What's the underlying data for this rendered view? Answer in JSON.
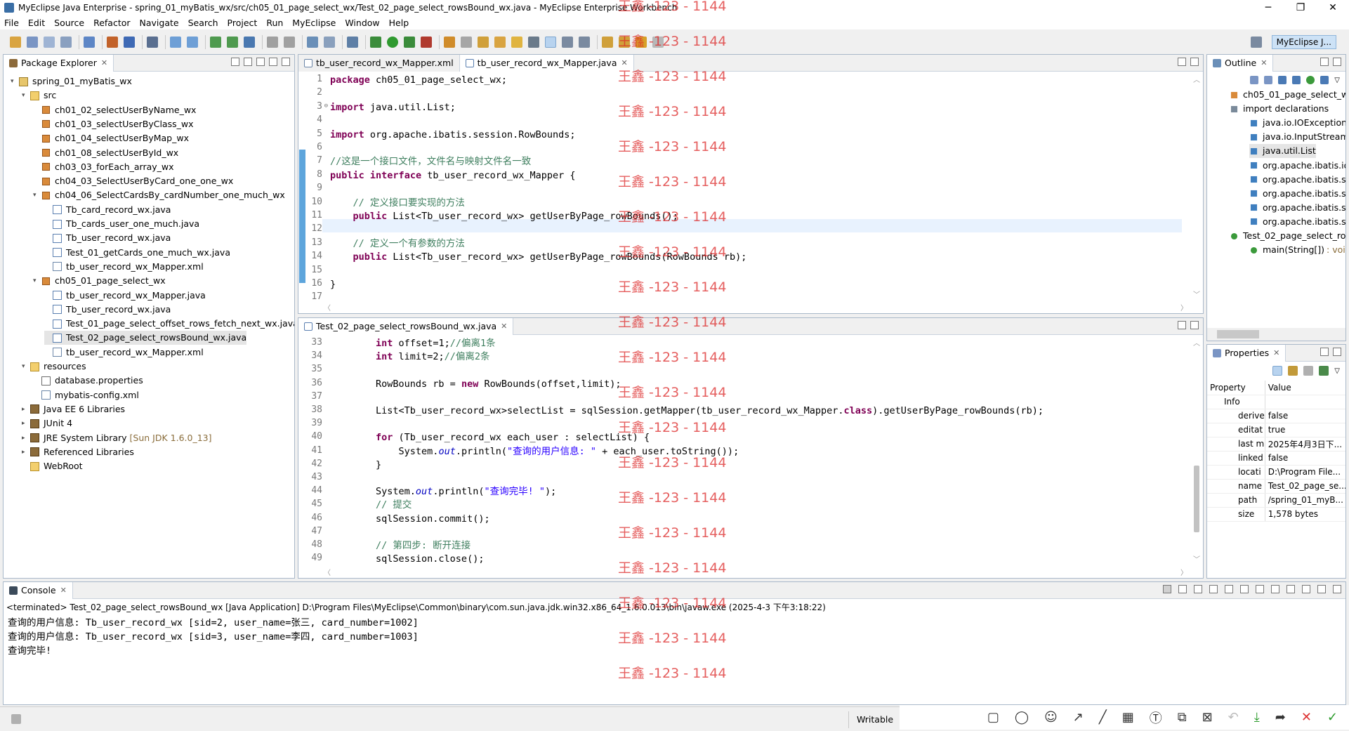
{
  "window": {
    "title": "MyEclipse Java Enterprise - spring_01_myBatis_wx/src/ch05_01_page_select_wx/Test_02_page_select_rowsBound_wx.java - MyEclipse Enterprise Workbench"
  },
  "menu": [
    "File",
    "Edit",
    "Source",
    "Refactor",
    "Navigate",
    "Search",
    "Project",
    "Run",
    "MyEclipse",
    "Window",
    "Help"
  ],
  "perspective_label": "MyEclipse J...",
  "package_explorer": {
    "tab": "Package Explorer",
    "items": [
      {
        "label": "spring_01_myBatis_wx",
        "icon": "project-icon"
      },
      {
        "label": "src",
        "icon": "source-folder-icon"
      },
      {
        "label": "ch01_02_selectUserByName_wx",
        "icon": "package-icon"
      },
      {
        "label": "ch01_03_selectUserByClass_wx",
        "icon": "package-icon"
      },
      {
        "label": "ch01_04_selectUserByMap_wx",
        "icon": "package-icon"
      },
      {
        "label": "ch01_08_selectUserById_wx",
        "icon": "package-icon"
      },
      {
        "label": "ch03_03_forEach_array_wx",
        "icon": "package-icon"
      },
      {
        "label": "ch04_03_SelectUserByCard_one_one_wx",
        "icon": "package-icon"
      },
      {
        "label": "ch04_06_SelectCardsBy_cardNumber_one_much_wx",
        "icon": "package-icon"
      },
      {
        "label": "Tb_card_record_wx.java",
        "icon": "java-file-icon"
      },
      {
        "label": "Tb_cards_user_one_much.java",
        "icon": "java-file-icon"
      },
      {
        "label": "Tb_user_record_wx.java",
        "icon": "java-file-icon"
      },
      {
        "label": "Test_01_getCards_one_much_wx.java",
        "icon": "java-file-icon"
      },
      {
        "label": "tb_user_record_wx_Mapper.xml",
        "icon": "xml-file-icon"
      },
      {
        "label": "ch05_01_page_select_wx",
        "icon": "package-icon"
      },
      {
        "label": "tb_user_record_wx_Mapper.java",
        "icon": "java-file-icon"
      },
      {
        "label": "Tb_user_record_wx.java",
        "icon": "java-file-icon"
      },
      {
        "label": "Test_01_page_select_offset_rows_fetch_next_wx.java",
        "icon": "java-file-icon"
      },
      {
        "label": "Test_02_page_select_rowsBound_wx.java",
        "icon": "java-file-icon"
      },
      {
        "label": "tb_user_record_wx_Mapper.xml",
        "icon": "xml-file-icon"
      },
      {
        "label": "resources",
        "icon": "source-folder-icon"
      },
      {
        "label": "database.properties",
        "icon": "properties-file-icon"
      },
      {
        "label": "mybatis-config.xml",
        "icon": "xml-file-icon"
      },
      {
        "label": "Java EE 6 Libraries",
        "icon": "library-icon"
      },
      {
        "label": "JUnit 4",
        "icon": "library-icon"
      },
      {
        "label": "JRE System Library",
        "suffix": "[Sun JDK 1.6.0_13]",
        "icon": "library-icon"
      },
      {
        "label": "Referenced Libraries",
        "icon": "library-icon"
      },
      {
        "label": "WebRoot",
        "icon": "folder-icon"
      }
    ]
  },
  "editor_top": {
    "tabs": [
      "tb_user_record_wx_Mapper.xml",
      "tb_user_record_wx_Mapper.java"
    ],
    "line_numbers": [
      "1",
      "2",
      "3",
      "4",
      "5",
      "6",
      "7",
      "8",
      "9",
      "10",
      "11",
      "12",
      "13",
      "14",
      "15",
      "16",
      "17"
    ],
    "fold_markers": [
      "",
      "",
      "⊖",
      "",
      "",
      "",
      "",
      "",
      "",
      "",
      "",
      "",
      "",
      "",
      "",
      "",
      ""
    ],
    "lines": [
      "<span class='kw'>package</span> ch05_01_page_select_wx;",
      "",
      "<span class='kw'>import</span> java.util.List;",
      "",
      "<span class='kw'>import</span> org.apache.ibatis.session.RowBounds;",
      "",
      "<span class='cm'>//这是一个接口文件，文件名与映射文件名一致</span>",
      "<span class='kw'>public</span> <span class='kw'>interface</span> tb_user_record_wx_Mapper {",
      "",
      "    <span class='cm'>// 定义接口要实现的方法</span>",
      "    <span class='kw'>public</span> List&lt;Tb_user_record_wx&gt; getUserByPage_rowBounds();",
      "",
      "    <span class='cm'>// 定义一个有参数的方法</span>",
      "    <span class='kw'>public</span> List&lt;Tb_user_record_wx&gt; getUserByPage_rowBounds(RowBounds rb);",
      "",
      "}",
      ""
    ]
  },
  "editor_bottom": {
    "tab": "Test_02_page_select_rowsBound_wx.java",
    "line_numbers": [
      "33",
      "34",
      "35",
      "36",
      "37",
      "38",
      "39",
      "40",
      "41",
      "42",
      "43",
      "44",
      "45",
      "46",
      "47",
      "48",
      "49"
    ],
    "lines": [
      "        <span class='kw'>int</span> offset=1;<span class='cm'>//偏离1条</span>",
      "        <span class='kw'>int</span> limit=2;<span class='cm'>//偏离2条</span>",
      "",
      "        RowBounds rb = <span class='kw'>new</span> RowBounds(offset,limit);",
      "",
      "        List&lt;Tb_user_record_wx&gt;selectList = sqlSession.getMapper(tb_user_record_wx_Mapper.<span class='kw'>class</span>).getUserByPage_rowBounds(rb);",
      "",
      "        <span class='kw'>for</span> (Tb_user_record_wx each_user : selectList) {",
      "            System.<span class='fld'>out</span>.println(<span class='st'>\"查询的用户信息: \"</span> + each_user.toString());",
      "        }",
      "",
      "        System.<span class='fld'>out</span>.println(<span class='st'>\"查询完毕! \"</span>);",
      "        <span class='cm'>// 提交</span>",
      "        sqlSession.commit();",
      "",
      "        <span class='cm'>// 第四步: 断开连接</span>",
      "        sqlSession.close();"
    ]
  },
  "outline": {
    "tab": "Outline",
    "items": [
      {
        "label": "ch05_01_page_select_wx",
        "icon": "package-icon"
      },
      {
        "label": "import declarations",
        "icon": "imports-icon"
      },
      {
        "label": "java.io.IOException",
        "icon": "import-icon"
      },
      {
        "label": "java.io.InputStream",
        "icon": "import-icon"
      },
      {
        "label": "java.util.List",
        "icon": "import-icon"
      },
      {
        "label": "org.apache.ibatis.io",
        "icon": "import-icon"
      },
      {
        "label": "org.apache.ibatis.se",
        "icon": "import-icon"
      },
      {
        "label": "org.apache.ibatis.se",
        "icon": "import-icon"
      },
      {
        "label": "org.apache.ibatis.se",
        "icon": "import-icon"
      },
      {
        "label": "org.apache.ibatis.se",
        "icon": "import-icon"
      },
      {
        "label": "Test_02_page_select_rov",
        "icon": "class-icon"
      },
      {
        "label": "main(String[])",
        "suffix": ": void",
        "icon": "method-icon"
      }
    ]
  },
  "properties": {
    "tab": "Properties",
    "headers": [
      "Property",
      "Value"
    ],
    "section": "Info",
    "rows": [
      [
        "derive",
        "false"
      ],
      [
        "editat",
        "true"
      ],
      [
        "last m",
        "2025年4月3日下..."
      ],
      [
        "linked",
        "false"
      ],
      [
        "locati",
        "D:\\Program File..."
      ],
      [
        "name",
        "Test_02_page_se..."
      ],
      [
        "path",
        "/spring_01_myB..."
      ],
      [
        "size",
        "1,578  bytes"
      ]
    ]
  },
  "console": {
    "tab": "Console",
    "header": "<terminated> Test_02_page_select_rowsBound_wx [Java Application] D:\\Program Files\\MyEclipse\\Common\\binary\\com.sun.java.jdk.win32.x86_64_1.6.0.013\\bin\\javaw.exe (2025-4-3 下午3:18:22)",
    "lines": [
      "查询的用户信息: Tb_user_record_wx [sid=2, user_name=张三, card_number=1002]",
      "查询的用户信息: Tb_user_record_wx [sid=3, user_name=李四, card_number=1003]",
      "查询完毕!"
    ]
  },
  "status": {
    "writable": "Writable"
  },
  "watermark": "王鑫 -123 - 1144"
}
